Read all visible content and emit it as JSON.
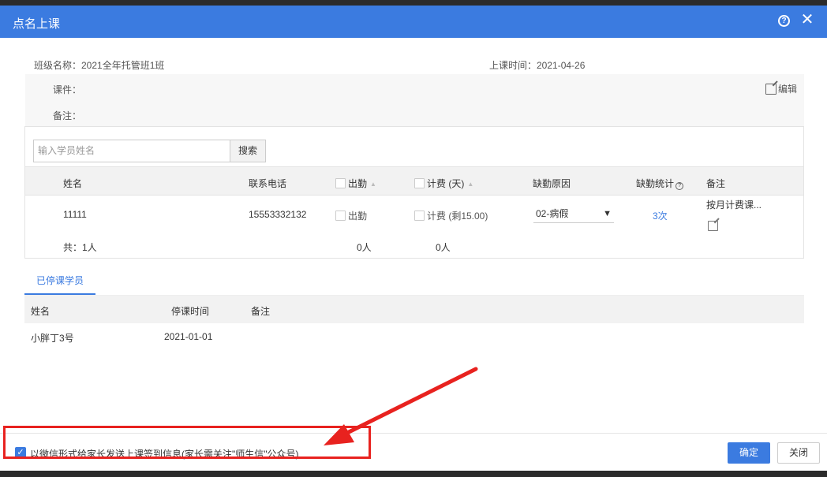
{
  "dialog": {
    "title": "点名上课"
  },
  "info": {
    "class_name": "班级名称：2021全年托管班1班",
    "class_time": "上课时间：2021-04-26",
    "courseware_label": "课件：",
    "remark_label": "备注：",
    "edit_label": "编辑"
  },
  "search": {
    "placeholder": "输入学员姓名",
    "button": "搜索"
  },
  "table": {
    "headers": {
      "name": "姓名",
      "phone": "联系电话",
      "attend": "出勤",
      "charge": "计费 (天)",
      "reason": "缺勤原因",
      "stats": "缺勤统计",
      "note": "备注"
    },
    "row": {
      "name": "11111",
      "phone": "15553332132",
      "attend": "出勤",
      "charge": "计费 (剩15.00)",
      "reason": "02-病假",
      "stats": "3次",
      "note": "按月计费课..."
    },
    "totals": {
      "count": "共：1人",
      "attend": "0人",
      "charge": "0人"
    }
  },
  "stopped": {
    "tab": "已停课学员",
    "headers": {
      "name": "姓名",
      "time": "停课时间",
      "note": "备注"
    },
    "row": {
      "name": "小胖丁3号",
      "time": "2021-01-01"
    }
  },
  "footer": {
    "wechat_notice": "以微信形式给家长发送上课签到信息(家长需关注\"师生信\"公众号)",
    "ok": "确定",
    "close": "关闭"
  },
  "colors": {
    "primary": "#3b7be0",
    "annotation": "#e8221f"
  }
}
